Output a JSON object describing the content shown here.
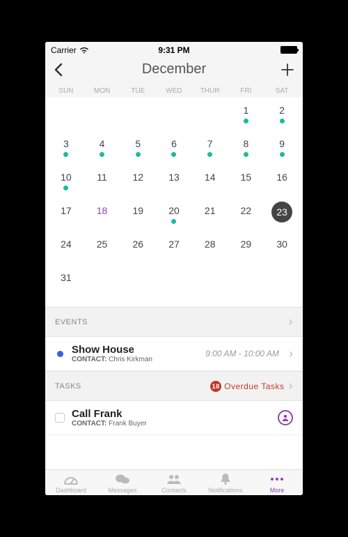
{
  "status": {
    "carrier": "Carrier",
    "time": "9:31 PM"
  },
  "nav": {
    "title": "December"
  },
  "calendar": {
    "dow": [
      "SUN",
      "MON",
      "TUE",
      "WED",
      "THUR",
      "FRI",
      "SAT"
    ],
    "weeks": [
      [
        null,
        null,
        null,
        null,
        null,
        {
          "d": 1,
          "dot": true
        },
        {
          "d": 2,
          "dot": true
        }
      ],
      [
        {
          "d": 3,
          "dot": true
        },
        {
          "d": 4,
          "dot": true
        },
        {
          "d": 5,
          "dot": true
        },
        {
          "d": 6,
          "dot": true
        },
        {
          "d": 7,
          "dot": true
        },
        {
          "d": 8,
          "dot": true
        },
        {
          "d": 9,
          "dot": true
        }
      ],
      [
        {
          "d": 10,
          "dot": true
        },
        {
          "d": 11
        },
        {
          "d": 12
        },
        {
          "d": 13
        },
        {
          "d": 14
        },
        {
          "d": 15
        },
        {
          "d": 16
        }
      ],
      [
        {
          "d": 17
        },
        {
          "d": 18,
          "purple": true
        },
        {
          "d": 19
        },
        {
          "d": 20,
          "dot": true
        },
        {
          "d": 21
        },
        {
          "d": 22
        },
        {
          "d": 23,
          "selected": true
        }
      ],
      [
        {
          "d": 24
        },
        {
          "d": 25
        },
        {
          "d": 26
        },
        {
          "d": 27
        },
        {
          "d": 28
        },
        {
          "d": 29
        },
        {
          "d": 30
        }
      ],
      [
        {
          "d": 31
        },
        null,
        null,
        null,
        null,
        null,
        null
      ]
    ]
  },
  "sections": {
    "events_label": "EVENTS",
    "tasks_label": "TASKS",
    "overdue_count": "18",
    "overdue_text": "Overdue Tasks"
  },
  "event": {
    "title": "Show House",
    "contact_label": "CONTACT:",
    "contact_name": "Chris Kirkman",
    "time": "9:00 AM - 10:00 AM"
  },
  "task": {
    "title": "Call Frank",
    "contact_label": "CONTACT:",
    "contact_name": "Frank Buyer"
  },
  "tabs": {
    "dashboard": "Dashboard",
    "messages": "Messages",
    "contacts": "Contacts",
    "notifications": "Notifications",
    "more": "More"
  }
}
